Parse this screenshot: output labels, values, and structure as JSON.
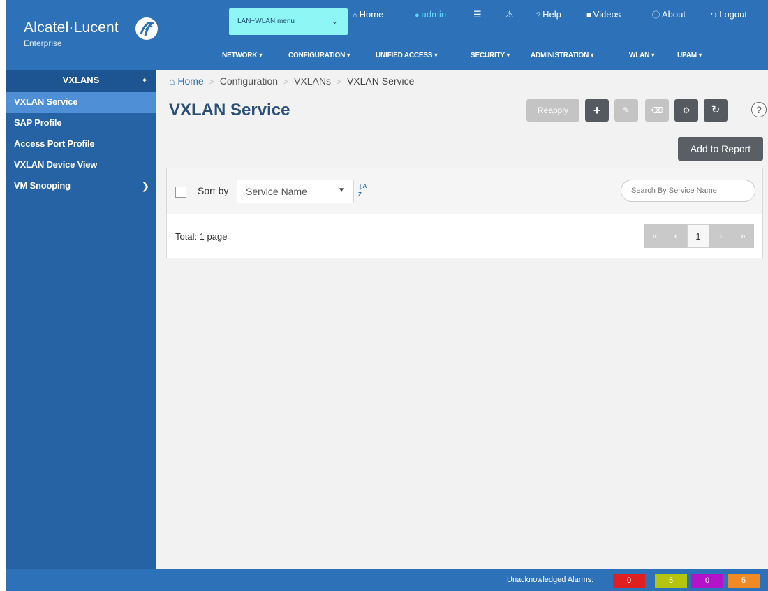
{
  "header": {
    "logo_text": "Alcatel·Lucent",
    "logo_sub": "Enterprise",
    "menu_select": "LAN+WLAN menu",
    "links": {
      "home": "Home",
      "admin": "admin",
      "help": "Help",
      "videos": "Videos",
      "about": "About",
      "logout": "Logout"
    },
    "nav": [
      "NETWORK ▾",
      "CONFIGURATION ▾",
      "UNIFIED ACCESS ▾",
      "SECURITY ▾",
      "ADMINISTRATION ▾",
      "WLAN ▾",
      "UPAM ▾"
    ]
  },
  "sidebar": {
    "title": "VXLANS",
    "items": [
      {
        "label": "VXLAN Service"
      },
      {
        "label": "SAP Profile"
      },
      {
        "label": "Access Port Profile"
      },
      {
        "label": "VXLAN Device View"
      },
      {
        "label": "VM Snooping"
      }
    ]
  },
  "breadcrumb": [
    "Home",
    "Configuration",
    "VXLANs",
    "VXLAN Service"
  ],
  "page_title": "VXLAN Service",
  "toolbar": {
    "reapply_label": "Reapply",
    "add_report_label": "Add to Report",
    "help_symbol": "?"
  },
  "list": {
    "sort_by_label": "Sort by",
    "sort_value": "Service Name",
    "sort_icon": "↓ᴬᶻ",
    "search_placeholder": "Search By Service Name",
    "total_text": "Total: 1 page",
    "pager": {
      "first": "«",
      "prev": "‹",
      "current": "1",
      "next": "›",
      "last": "»"
    }
  },
  "footer": {
    "alarms_label": "Unacknowledged Alarms:",
    "alarms": [
      {
        "value": "0",
        "color": "#e02020"
      },
      {
        "value": "5",
        "color": "#b5c40e"
      },
      {
        "value": "0",
        "color": "#b313c9"
      },
      {
        "value": "5",
        "color": "#ef8a24"
      }
    ]
  }
}
